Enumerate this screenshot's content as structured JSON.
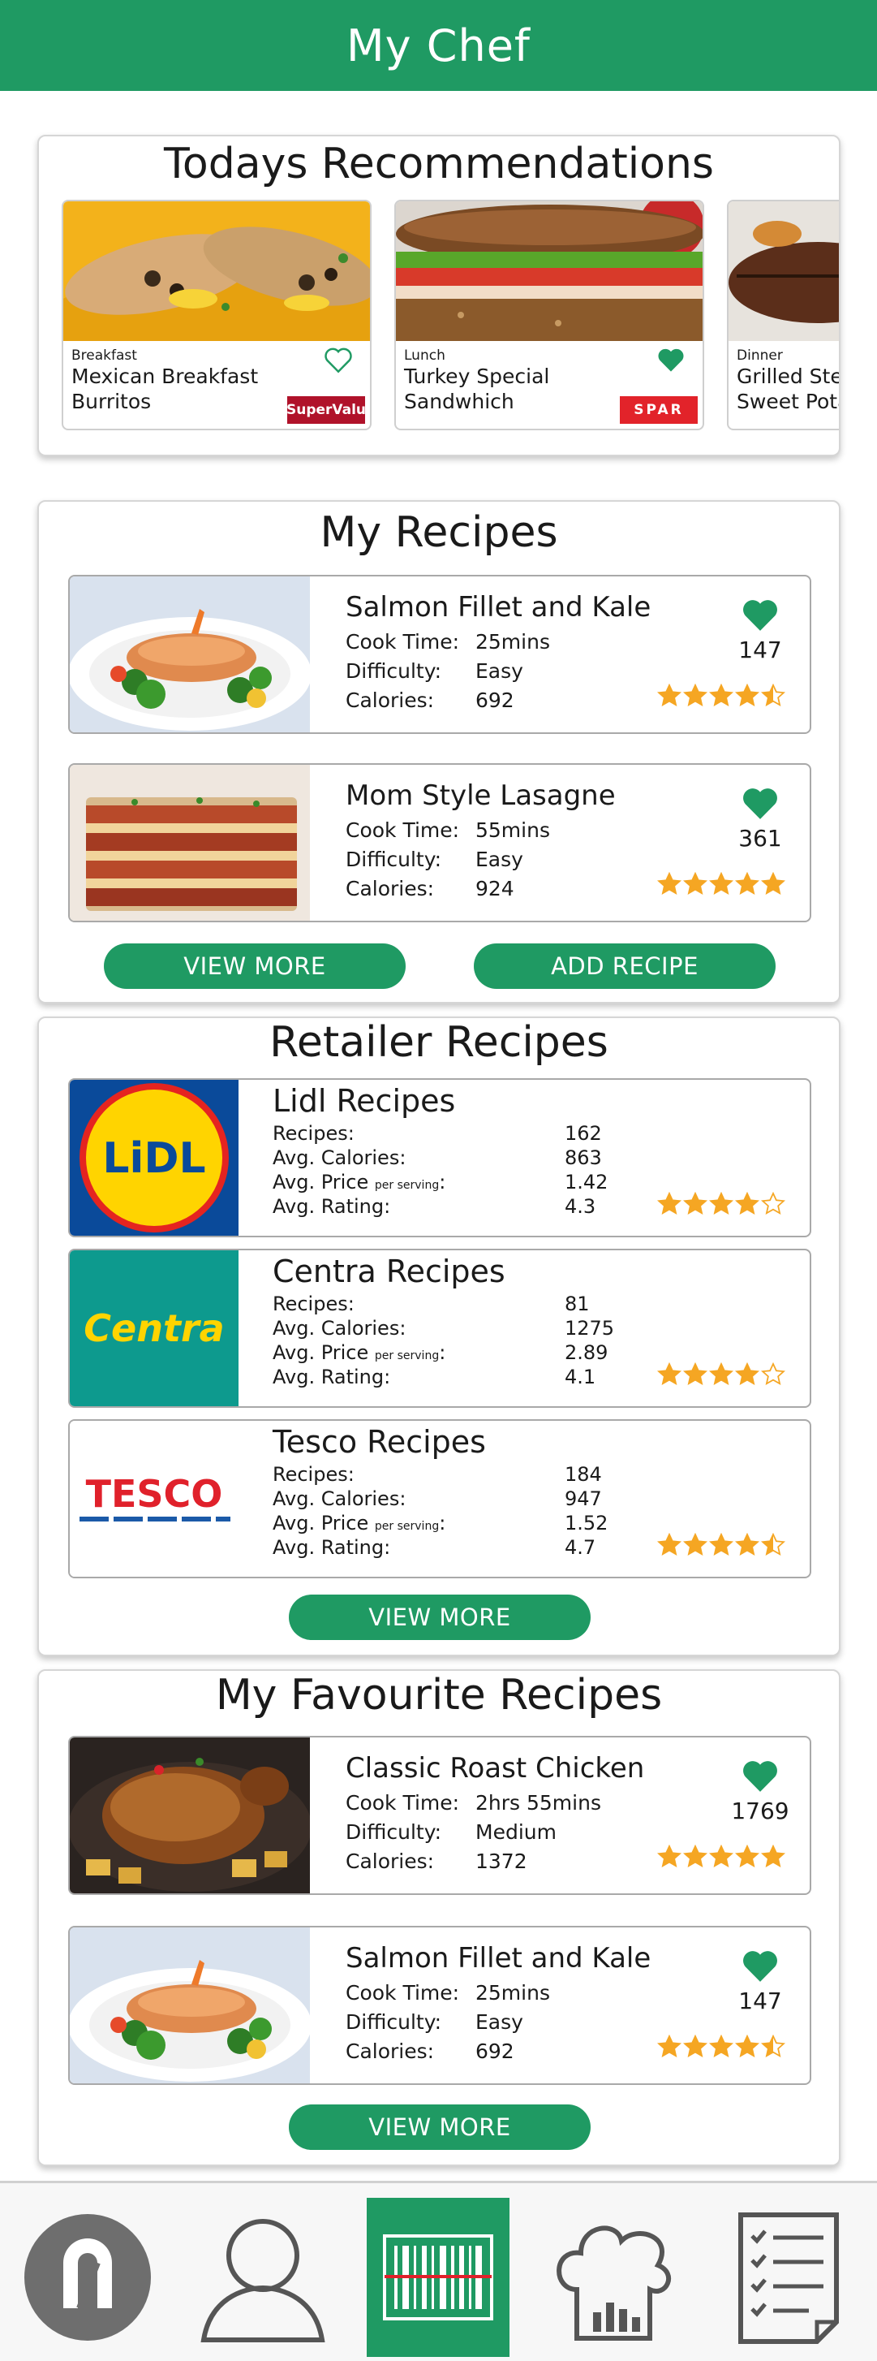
{
  "app": {
    "title": "My Chef"
  },
  "recommendations": {
    "title": "Todays Recommendations",
    "items": [
      {
        "meal": "Breakfast",
        "name": "Mexican Breakfast Burritos",
        "retailer": "SuperValu",
        "favourited": false
      },
      {
        "meal": "Lunch",
        "name": "Turkey Special Sandwhich",
        "retailer": "SPAR",
        "favourited": true
      },
      {
        "meal": "Dinner",
        "name": "Grilled Steak Sweet Potato",
        "retailer": "",
        "favourited": false
      }
    ]
  },
  "my_recipes": {
    "title": "My Recipes",
    "labels": {
      "cook_time": "Cook Time:",
      "difficulty": "Difficulty:",
      "calories": "Calories:"
    },
    "items": [
      {
        "name": "Salmon Fillet and Kale",
        "cook_time": "25mins",
        "difficulty": "Easy",
        "calories": "692",
        "likes": "147",
        "rating": 4.5
      },
      {
        "name": "Mom Style Lasagne",
        "cook_time": "55mins",
        "difficulty": "Easy",
        "calories": "924",
        "likes": "361",
        "rating": 5
      }
    ],
    "view_more_label": "VIEW MORE",
    "add_recipe_label": "ADD RECIPE"
  },
  "retailer_recipes": {
    "title": "Retailer Recipes",
    "labels": {
      "recipes": "Recipes:",
      "avg_calories": "Avg. Calories:",
      "avg_price": "Avg. Price",
      "per_serving": "per serving",
      "colon": ":",
      "avg_rating": "Avg. Rating:"
    },
    "items": [
      {
        "name": "Lidl Recipes",
        "logo_text": "LiDL",
        "recipes": "162",
        "avg_calories": "863",
        "avg_price": "1.42",
        "avg_rating": "4.3",
        "rating": 4
      },
      {
        "name": "Centra Recipes",
        "logo_text": "Centra",
        "recipes": "81",
        "avg_calories": "1275",
        "avg_price": "2.89",
        "avg_rating": "4.1",
        "rating": 4
      },
      {
        "name": "Tesco Recipes",
        "logo_text": "TESCO",
        "recipes": "184",
        "avg_calories": "947",
        "avg_price": "1.52",
        "avg_rating": "4.7",
        "rating": 4.5
      }
    ],
    "view_more_label": "VIEW MORE"
  },
  "favourite_recipes": {
    "title": "My Favourite Recipes",
    "items": [
      {
        "name": "Classic Roast Chicken",
        "cook_time": "2hrs 55mins",
        "difficulty": "Medium",
        "calories": "1372",
        "likes": "1769",
        "rating": 5
      },
      {
        "name": "Salmon Fillet and Kale",
        "cook_time": "25mins",
        "difficulty": "Easy",
        "calories": "692",
        "likes": "147",
        "rating": 4.5
      }
    ],
    "view_more_label": "VIEW MORE"
  },
  "bottom_nav": {
    "items": [
      {
        "icon": "app-logo-icon",
        "active": false
      },
      {
        "icon": "profile-icon",
        "active": false
      },
      {
        "icon": "barcode-scanner-icon",
        "active": true
      },
      {
        "icon": "chef-stats-icon",
        "active": false
      },
      {
        "icon": "checklist-icon",
        "active": false
      }
    ]
  },
  "colors": {
    "brand_green": "#1f9a63",
    "star_orange": "#f5a623",
    "heart_green": "#1f9a63"
  }
}
